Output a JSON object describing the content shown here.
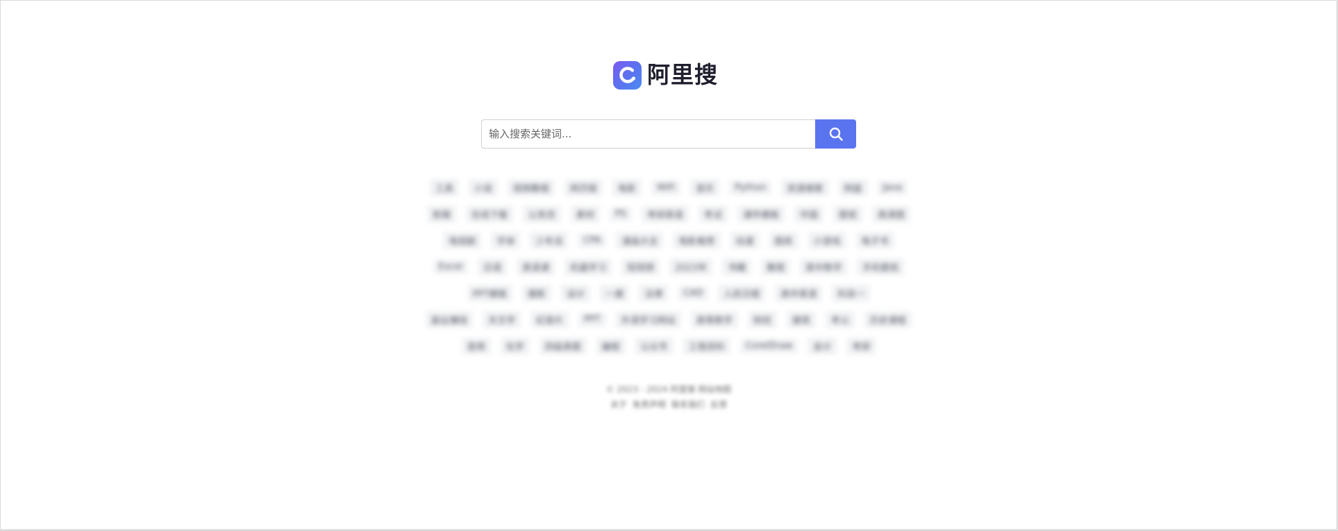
{
  "brand": {
    "name": "阿里搜",
    "accent": "#5a74f0"
  },
  "search": {
    "placeholder": "输入搜索关键词...",
    "button_icon": "search-icon"
  },
  "hot_words": [
    [
      "工具",
      "小说",
      "视频教程",
      "网页版",
      "电影",
      "WiFi",
      "音乐",
      "Python",
      "资源搜索",
      "网盘",
      "Java"
    ],
    [
      "剪辑",
      "在线下载",
      "公务员",
      "素材",
      "PS",
      "考研英语",
      "考试",
      "课件模板",
      "中国",
      "壁纸",
      "高清图"
    ],
    [
      "电视剧",
      "字体",
      "少年派",
      "CPA",
      "漫画大全",
      "电影推荐",
      "动漫",
      "图库",
      "小游戏",
      "电子书"
    ],
    [
      "Excel",
      "日语",
      "英语课",
      "机器学习",
      "短视频",
      "2023年",
      "书籍",
      "教程",
      "高中数学",
      "手机壁纸"
    ],
    [
      "PPT模板",
      "摄影",
      "设计",
      "一建",
      "法律",
      "CAD",
      "人民日报",
      "高中英语",
      "科目一"
    ],
    [
      "副业赚钱",
      "天文学",
      "纪录片",
      "PPT",
      "外语学习网站",
      "高等数学",
      "财经",
      "建筑",
      "考公",
      "历史课程"
    ],
    [
      "音频",
      "化学",
      "四级真题",
      "编程",
      "公众号",
      "工程资料",
      "CorelDraw",
      "会计",
      "考研"
    ]
  ],
  "footer": {
    "copyright": "© 2023 - 2024 阿里搜 网站地图",
    "links": [
      "关于",
      "免责声明",
      "联系我们",
      "反馈"
    ]
  }
}
